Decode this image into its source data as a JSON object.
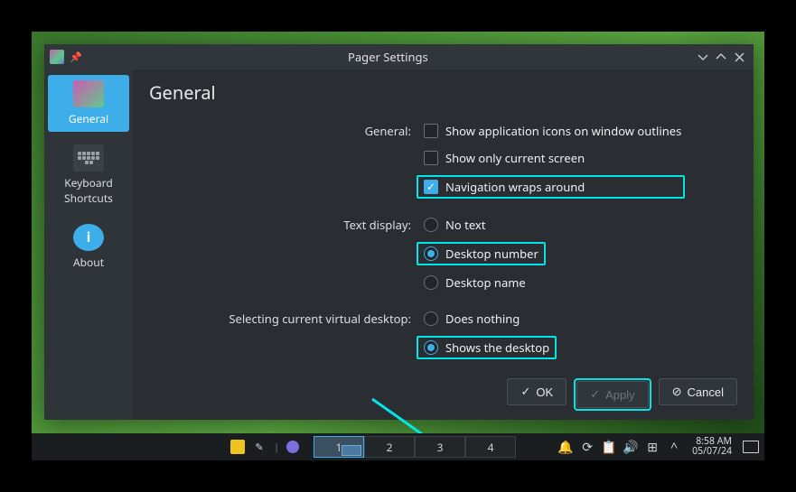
{
  "window": {
    "title": "Pager Settings"
  },
  "sidebar": {
    "items": [
      {
        "label": "General"
      },
      {
        "label": "Keyboard Shortcuts"
      },
      {
        "label": "About"
      }
    ]
  },
  "page": {
    "heading": "General",
    "groups": {
      "general": {
        "label": "General:",
        "opts": [
          {
            "label": "Show application icons on window outlines"
          },
          {
            "label": "Show only current screen"
          },
          {
            "label": "Navigation wraps around"
          }
        ]
      },
      "text": {
        "label": "Text display:",
        "opts": [
          {
            "label": "No text"
          },
          {
            "label": "Desktop number"
          },
          {
            "label": "Desktop name"
          }
        ]
      },
      "select": {
        "label": "Selecting current virtual desktop:",
        "opts": [
          {
            "label": "Does nothing"
          },
          {
            "label": "Shows the desktop"
          }
        ]
      }
    }
  },
  "buttons": {
    "ok": "OK",
    "apply": "Apply",
    "cancel": "Cancel"
  },
  "taskbar": {
    "pager": [
      "1",
      "2",
      "3",
      "4"
    ],
    "clock": {
      "time": "8:58 AM",
      "date": "05/07/24"
    }
  }
}
